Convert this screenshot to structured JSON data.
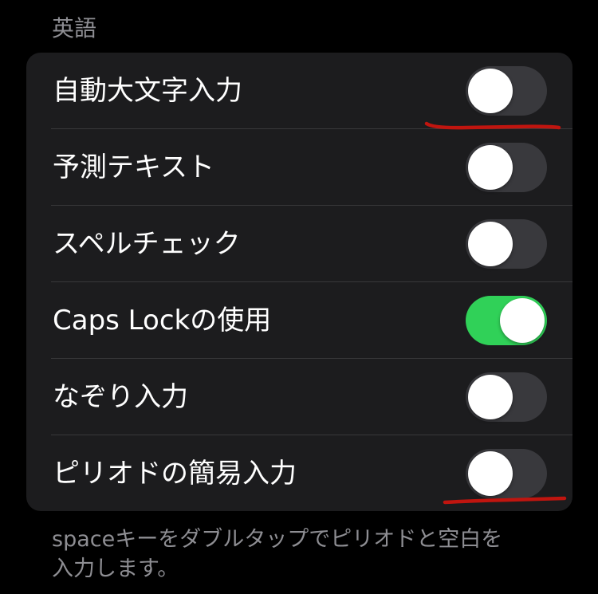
{
  "section": {
    "header": "英語"
  },
  "settings": {
    "rows": [
      {
        "label": "自動大文字入力",
        "on": false
      },
      {
        "label": "予測テキスト",
        "on": false
      },
      {
        "label": "スペルチェック",
        "on": false
      },
      {
        "label": "Caps Lockの使用",
        "on": true
      },
      {
        "label": "なぞり入力",
        "on": false
      },
      {
        "label": "ピリオドの簡易入力",
        "on": false
      }
    ]
  },
  "footer": {
    "line1": "spaceキーをダブルタップでピリオドと空白を",
    "line2": "入力します。"
  },
  "colors": {
    "background": "#000000",
    "group_background": "#1c1c1e",
    "toggle_on": "#30d158",
    "toggle_off": "#39393d",
    "annotation": "#c0150f",
    "secondary_text": "#8e8e93"
  }
}
